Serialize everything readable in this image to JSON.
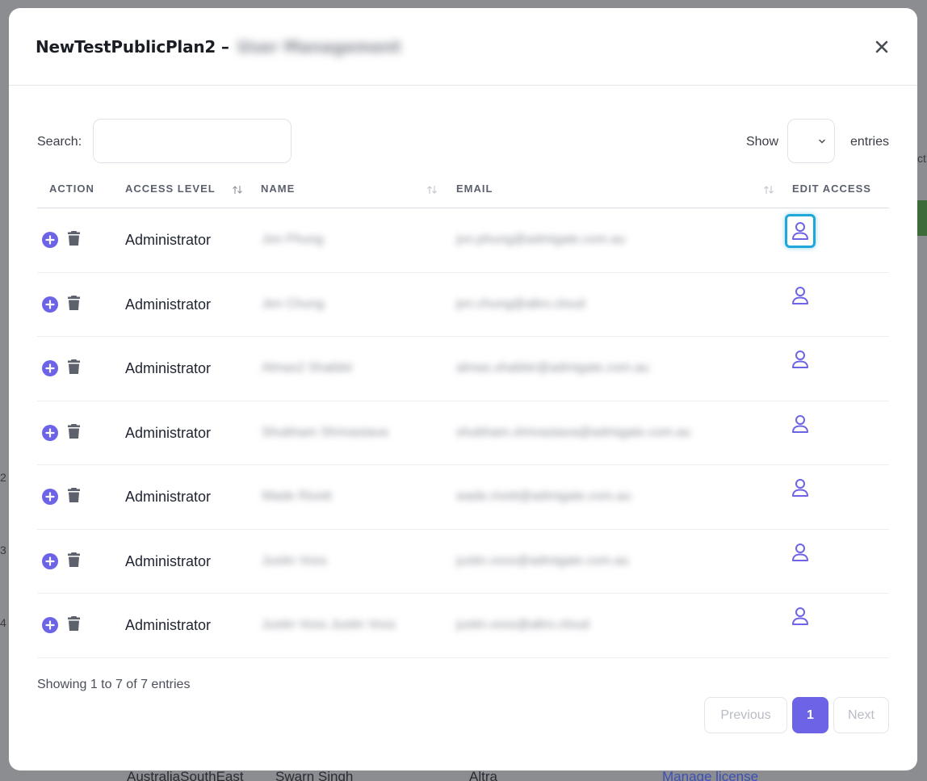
{
  "modal": {
    "title": "NewTestPublicPlan2 –",
    "title_blurred": "User Management"
  },
  "controls": {
    "search_label": "Search:",
    "search_value": "",
    "show_label": "Show",
    "entries_label": "entries",
    "entries_value": ""
  },
  "table": {
    "headers": [
      "ACTION",
      "ACCESS LEVEL",
      "NAME",
      "EMAIL",
      "EDIT ACCESS"
    ],
    "rows": [
      {
        "level": "Administrator",
        "name": "Jon Phung",
        "email": "jon.phung@admigate.com.au"
      },
      {
        "level": "Administrator",
        "name": "Jen Chung",
        "email": "jen.chung@altro.cloud"
      },
      {
        "level": "Administrator",
        "name": "Almas2 Shabbir",
        "email": "almas.shabbir@admigate.com.au"
      },
      {
        "level": "Administrator",
        "name": "Shubham Shrivastava",
        "email": "shubham.shrivastava@admigate.com.au"
      },
      {
        "level": "Administrator",
        "name": "Wade Rivett",
        "email": "wade.rivett@admigate.com.au"
      },
      {
        "level": "Administrator",
        "name": "Justin Voss",
        "email": "justin.voss@admigate.com.au"
      },
      {
        "level": "Administrator",
        "name": "Justin Voss Justin Voss",
        "email": "justin.voss@altro.cloud"
      }
    ]
  },
  "footer": {
    "info": "Showing 1 to 7 of 7 entries",
    "prev": "Previous",
    "current": "1",
    "next": "Next"
  },
  "background": {
    "region": "AustraliaSouthEast",
    "owner": "Swarn Singh",
    "product": "Altra",
    "link": "Manage license",
    "side_nums": [
      "2",
      "3",
      "4"
    ],
    "side_text": "ct"
  },
  "colors": {
    "accent": "#6c63e6",
    "focus": "#1ea7d8",
    "icon": "#6c63e6"
  },
  "icons": {
    "add": "plus-circle-icon",
    "delete": "trash-icon",
    "edit_access": "user-icon",
    "close": "close-icon",
    "sort": "sort-arrows-icon",
    "select": "chevron-down-icon"
  }
}
